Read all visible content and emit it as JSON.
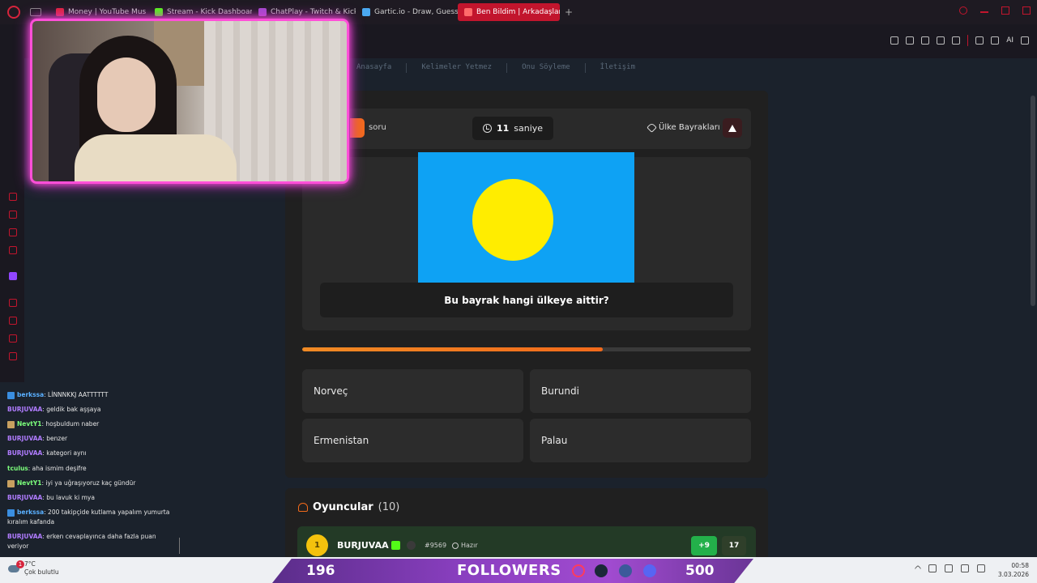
{
  "browser": {
    "tabs": [
      {
        "label": "Money | YouTube Mus",
        "color": "#e0243c"
      },
      {
        "label": "Stream - Kick Dashboard",
        "color": "#53fc18"
      },
      {
        "label": "ChatPlay - Twitch & Kick",
        "color": "#a64bd0"
      },
      {
        "label": "Gartic.io - Draw, Guess, W",
        "color": "#4aa8f0"
      },
      {
        "label": "Ben Bildim | Arkadaşlarını",
        "color": "#ff6a6a"
      }
    ],
    "tab_plus": "+",
    "ai_label": "AI"
  },
  "site_nav": [
    "Anasayfa",
    "Kelimeler Yetmez",
    "Onu Söyleme",
    "İletişim"
  ],
  "game": {
    "question_label": "soru",
    "timer_value": "11",
    "timer_unit": "saniye",
    "category": "Ülke Bayrakları",
    "question": "Bu bayrak hangi ülkeye aittir?",
    "progress": 0.67,
    "flag": {
      "background": "#0ea2f4",
      "circle": "#ffed00"
    },
    "answers": [
      "Norveç",
      "Burundi",
      "Ermenistan",
      "Palau"
    ]
  },
  "players": {
    "title": "Oyuncular",
    "count": "(10)",
    "rows": [
      {
        "rank": "1",
        "name": "BURJUVAA",
        "id": "#9569",
        "status": "Hazır",
        "plus": "+9",
        "score": "17"
      }
    ]
  },
  "chat": [
    {
      "user": "berkssa",
      "color": "#5ab0ff",
      "icon": "#3a8ee0",
      "text": ": LİNNNKKJ AATTTTTT"
    },
    {
      "user": "BURJUVAA",
      "color": "#b07cff",
      "icon": "",
      "text": ": geldik bak aşşaya"
    },
    {
      "user": "NevtY1",
      "color": "#7cff7c",
      "icon": "#c8a060",
      "text": ": hoşbuldum naber"
    },
    {
      "user": "BURJUVAA",
      "color": "#b07cff",
      "icon": "",
      "text": ": benzer"
    },
    {
      "user": "BURJUVAA",
      "color": "#b07cff",
      "icon": "",
      "text": ": kategori aynı"
    },
    {
      "user": "tculus",
      "color": "#7cff7c",
      "icon": "",
      "text": ": aha ismim deşifre"
    },
    {
      "user": "NevtY1",
      "color": "#7cff7c",
      "icon": "#c8a060",
      "text": ": iyi ya uğraşıyoruz kaç gündür"
    },
    {
      "user": "BURJUVAA",
      "color": "#b07cff",
      "icon": "",
      "text": ": bu lavuk ki mya"
    },
    {
      "user": "berkssa",
      "color": "#5ab0ff",
      "icon": "#3a8ee0",
      "text": ": 200 takipçide kutlama yapalım yumurta kıralım kafanda"
    },
    {
      "user": "BURJUVAA",
      "color": "#b07cff",
      "icon": "",
      "text": ": erken cevaplayınca daha fazla puan veriyor"
    }
  ],
  "taskbar": {
    "notif_count": "1",
    "temp": "7°C",
    "weather": "Çok bulutlu",
    "followers_current": "196",
    "followers_label": "FOLLOWERS",
    "followers_goal": "500",
    "time": "00:58",
    "date": "3.03.2026"
  }
}
